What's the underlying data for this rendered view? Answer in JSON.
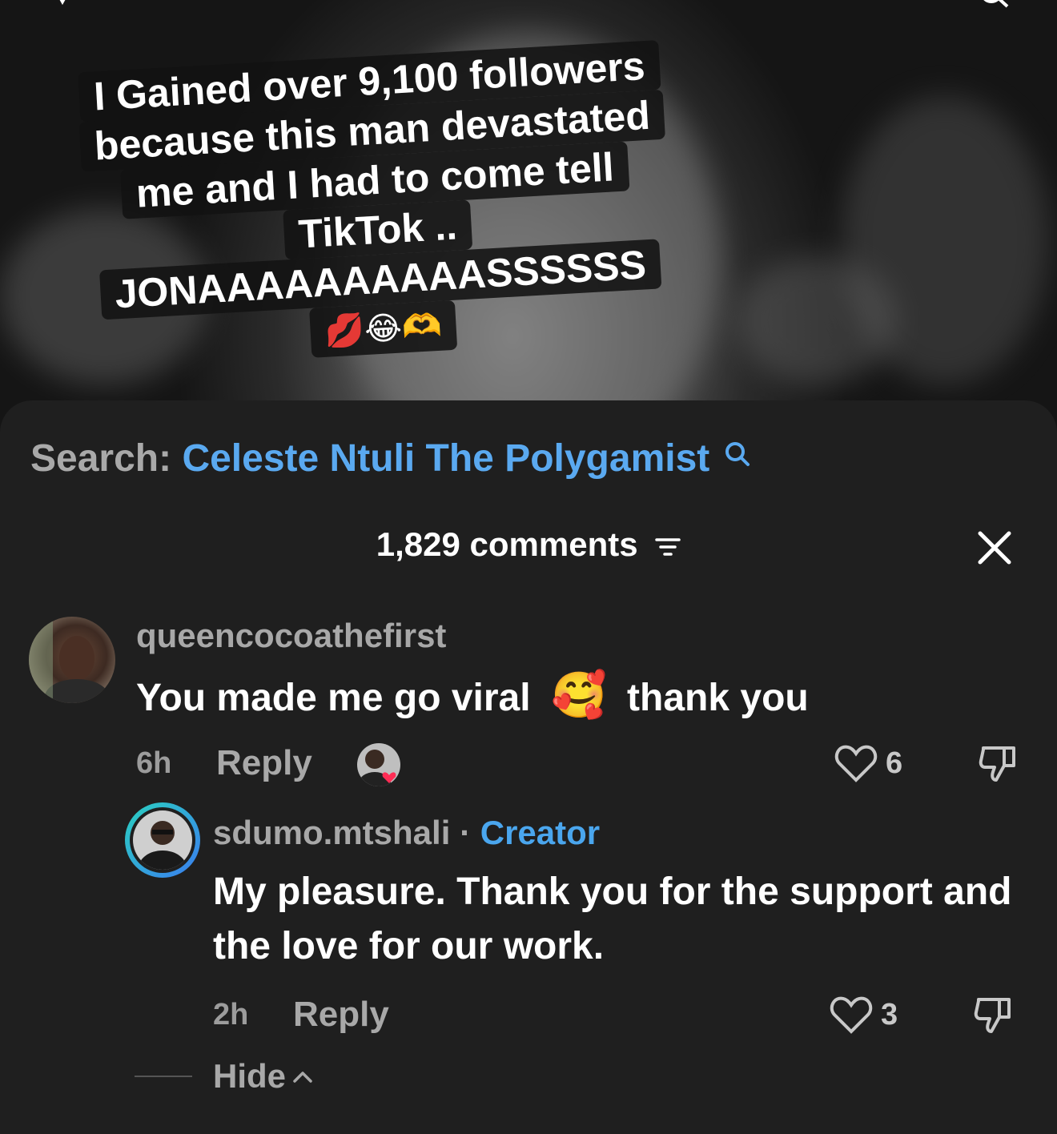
{
  "video": {
    "caption_lines": [
      "I Gained over 9,100 followers",
      "because this man devastated",
      "me and I had to come tell",
      "TikTok ..",
      "JONAAAAAAAAAASSSSSS"
    ],
    "caption_emojis": "💋😂🫶"
  },
  "search": {
    "prefix": "Search:",
    "term": "Celeste Ntuli The Polygamist"
  },
  "comments_panel": {
    "title": "1,829 comments",
    "comments": [
      {
        "username": "queencocoathefirst",
        "text_before": "You made me go viral",
        "emoji": "🥰",
        "text_after": "thank you",
        "time": "6h",
        "reply_label": "Reply",
        "likes": "6"
      },
      {
        "username": "sdumo.mtshali",
        "separator": "·",
        "badge": "Creator",
        "text": "My pleasure. Thank you for the support and the love for our work.",
        "time": "2h",
        "reply_label": "Reply",
        "likes": "3"
      }
    ],
    "hide_label": "Hide"
  },
  "colors": {
    "background": "#1f1f1f",
    "accent_blue": "#5aa9f0",
    "creator_blue": "#4aa6ee"
  },
  "icons": [
    "search-icon",
    "filter-icon",
    "close-icon",
    "heart-icon",
    "dislike-icon",
    "chevron-up-icon"
  ]
}
